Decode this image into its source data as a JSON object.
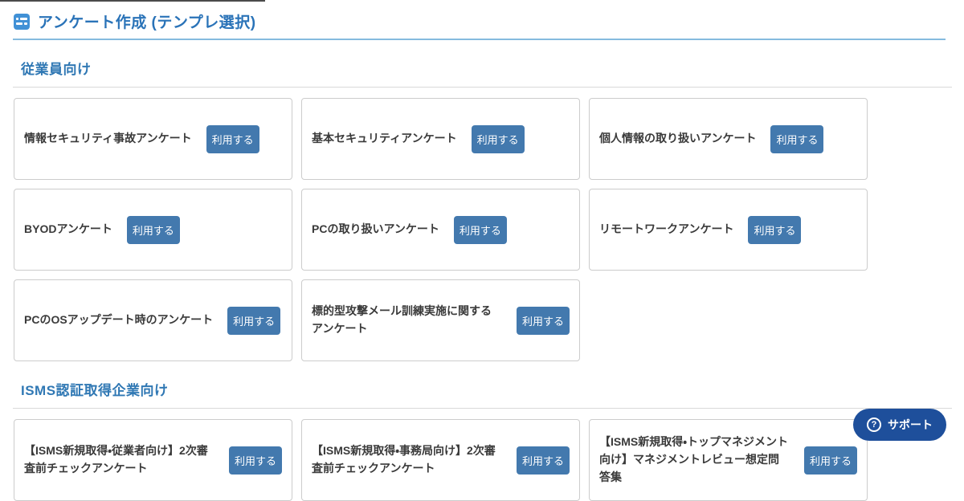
{
  "header": {
    "title": "アンケート作成 (テンプレ選択)",
    "icon": "survey-form-icon"
  },
  "sections": [
    {
      "heading": "従業員向け",
      "cards": [
        {
          "title": "情報セキュリティ事故アンケート",
          "button": "利用する"
        },
        {
          "title": "基本セキュリティアンケート",
          "button": "利用する"
        },
        {
          "title": "個人情報の取り扱いアンケート",
          "button": "利用する"
        },
        {
          "title": "BYODアンケート",
          "button": "利用する"
        },
        {
          "title": "PCの取り扱いアンケート",
          "button": "利用する"
        },
        {
          "title": "リモートワークアンケート",
          "button": "利用する"
        },
        {
          "title": "PCのOSアップデート時のアンケート",
          "button": "利用する"
        },
        {
          "title": "標的型攻撃メール訓練実施に関するアンケート",
          "button": "利用する"
        }
      ]
    },
    {
      "heading": "ISMS認証取得企業向け",
      "cards": [
        {
          "title": "【ISMS新規取得・従業者向け】2次審査前チェックアンケート",
          "button": "利用する"
        },
        {
          "title": "【ISMS新規取得・事務局向け】2次審査前チェックアンケート",
          "button": "利用する"
        },
        {
          "title": "【ISMS新規取得・トップマネジメント向け】マネジメントレビュー想定問答集",
          "button": "利用する"
        }
      ]
    }
  ],
  "support": {
    "label": "サポート",
    "icon": "question-circle-icon",
    "icon_glyph": "?"
  },
  "colors": {
    "accent_blue": "#2a73b8",
    "section_blue": "#3078b4",
    "button_blue": "#4379ae",
    "support_blue": "#1e4f9b",
    "title_divider_blue": "#85bbdf",
    "section_divider_gray": "#d9d9d9",
    "card_border": "#cccccc"
  }
}
